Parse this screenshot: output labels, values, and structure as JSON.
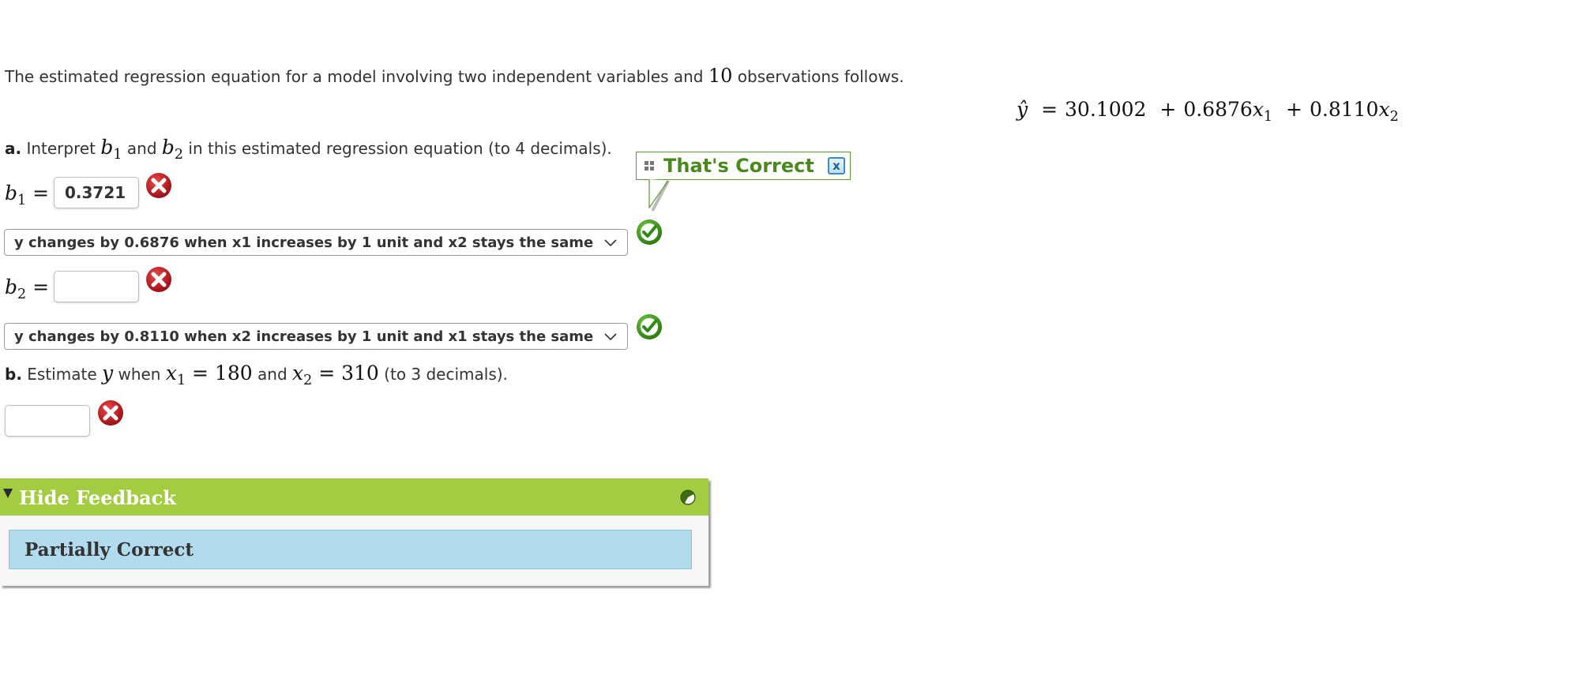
{
  "question": {
    "intro_before": "The estimated regression equation for a model involving two independent variables and ",
    "intro_num": "10",
    "intro_after": " observations follows.",
    "equation": {
      "lhs": "ŷ",
      "intercept": "30.1002",
      "b1": "0.6876",
      "x1": "x",
      "x1_sub": "1",
      "b2": "0.8110",
      "x2": "x",
      "x2_sub": "2",
      "plus": "+",
      "equals": "="
    }
  },
  "part_a": {
    "label": "a.",
    "text_1": " Interpret ",
    "b1_sym": "b",
    "b1_sub": "1",
    "text_2": " and ",
    "b2_sym": "b",
    "b2_sub": "2",
    "text_3": " in this estimated regression equation (to 4 decimals).",
    "b1": {
      "symbol": "b",
      "sub": "1",
      "equals": "=",
      "value": "0.3721",
      "status": "incorrect",
      "status_icon": "x-circle-icon"
    },
    "interpretation_1": {
      "selected": "y changes by 0.6876 when x1 increases by 1 unit and x2 stays the same",
      "status": "correct",
      "status_icon": "check-circle-icon"
    },
    "b2": {
      "symbol": "b",
      "sub": "2",
      "equals": "=",
      "value": "",
      "status": "incorrect",
      "status_icon": "x-circle-icon"
    },
    "interpretation_2": {
      "selected": "y changes by 0.8110 when x2 increases by 1 unit and x1 stays the same",
      "status": "correct",
      "status_icon": "check-circle-icon"
    }
  },
  "part_b": {
    "label": "b.",
    "text_1": " Estimate ",
    "y_sym": "y",
    "text_2": " when ",
    "x1_sym": "x",
    "x1_sub": "1",
    "x1_eq": " = 180",
    "text_3": " and ",
    "x2_sym": "x",
    "x2_sub": "2",
    "x2_eq": " = 310",
    "text_4": " (to 3 decimals).",
    "answer_value": "",
    "status": "incorrect",
    "status_icon": "x-circle-icon"
  },
  "tooltip": {
    "message": "That's Correct",
    "close_label": "x"
  },
  "feedback": {
    "toggle_label": "Hide Feedback",
    "status": "Partially Correct"
  },
  "colors": {
    "correct_green": "#4a8a1c",
    "feedback_header": "#a3cc43",
    "feedback_status_bg": "#b3dbee",
    "incorrect_red": "#c8202a"
  }
}
